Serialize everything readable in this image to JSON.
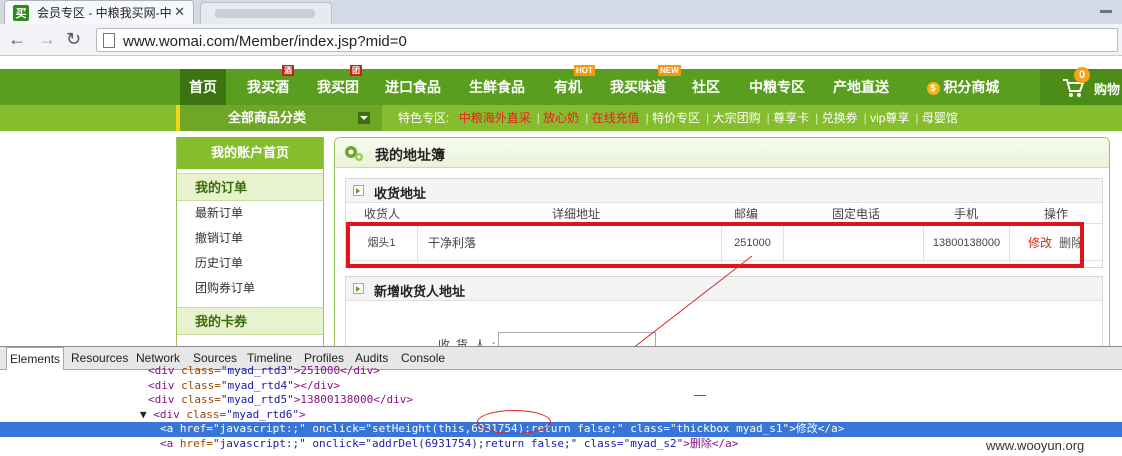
{
  "browser": {
    "active_tab_title": "会员专区 - 中粮我买网-中",
    "favicon_text": "买",
    "url": "www.womai.com/Member/index.jsp?mid=0"
  },
  "site": {
    "main_nav": [
      {
        "label": "首页"
      },
      {
        "label": "我买酒",
        "badge": "酒"
      },
      {
        "label": "我买团",
        "badge": "团"
      },
      {
        "label": "进口食品"
      },
      {
        "label": "生鲜食品"
      },
      {
        "label": "有机",
        "badge": "HOT"
      },
      {
        "label": "我买味道",
        "badge": "NEW"
      },
      {
        "label": "社区"
      },
      {
        "label": "中粮专区"
      },
      {
        "label": "产地直送"
      },
      {
        "label": "积分商城"
      }
    ],
    "cart_count": "0",
    "cart_label": "购物",
    "all_categories": "全部商品分类",
    "feature_label": "特色专区:",
    "feature_links": [
      "中粮海外直采",
      "放心奶",
      "在线充值",
      "特价专区",
      "大宗团购",
      "尊享卡",
      "兑换券",
      "vip尊享",
      "母婴馆"
    ]
  },
  "sidebar": {
    "home": "我的账户首页",
    "orders_section": "我的订单",
    "order_items": [
      "最新订单",
      "撤销订单",
      "历史订单",
      "团购券订单"
    ],
    "cards_section": "我的卡券"
  },
  "address_book": {
    "title": "我的地址簿",
    "shipping_section": "收货地址",
    "columns": [
      "收货人",
      "详细地址",
      "邮编",
      "固定电话",
      "手机",
      "操作"
    ],
    "row": {
      "name": "烟头1",
      "address": "干净利落",
      "zip": "251000",
      "phone": "",
      "mobile": "13800138000",
      "edit": "修改",
      "delete": "删除"
    },
    "new_section": "新增收货人地址",
    "form_label": "收货人:"
  },
  "devtools": {
    "tabs": [
      "Elements",
      "Resources",
      "Network",
      "Sources",
      "Timeline",
      "Profiles",
      "Audits",
      "Console"
    ],
    "lines": [
      {
        "indent": "    ",
        "pre": "<div ",
        "attr": "class=",
        "val": "\"myad_rtd3\"",
        "post": ">251000</div>"
      },
      {
        "indent": "    ",
        "pre": "<div ",
        "attr": "class=",
        "val": "\"myad_rtd4\"",
        "post": "></div>"
      },
      {
        "indent": "    ",
        "pre": "<div ",
        "attr": "class=",
        "val": "\"myad_rtd5\"",
        "post": ">13800138000</div>"
      },
      {
        "indent": "  ▼ ",
        "pre": "<div ",
        "attr": "class=",
        "val": "\"myad_rtd6\"",
        "post": ">"
      },
      {
        "indent": "      ",
        "pre": "<a ",
        "attr": "href=",
        "val": "\"javascript:;\" onclick=\"setHeight(this,6931754);return false;\" class=\"thickbox myad_s1\"",
        "post": ">修改</a>"
      },
      {
        "indent": "      ",
        "pre": "<a ",
        "attr": "href=",
        "val": "\"javascript:;\" onclick=\"addrDel(6931754);return false;\" class=\"myad_s2\"",
        "post": ">删除</a>"
      }
    ]
  },
  "watermark": "www.wooyun.org",
  "colors": {
    "brand_green": "#5a9e1f",
    "highlight_red": "#e1131d",
    "selection_blue": "#3875d7"
  }
}
